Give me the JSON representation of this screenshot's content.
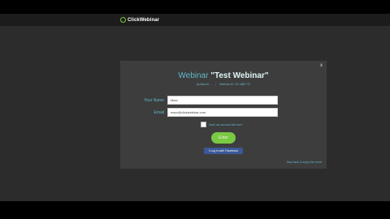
{
  "app": {
    "logo_text": "ClickWebinar"
  },
  "modal": {
    "close_label": "x",
    "title_prefix": "Webinar ",
    "title_name": "\"Test Webinar\"",
    "host_text": "by Marcel ....",
    "webinar_id_text": "Webinar ID: 207-888-772",
    "name_label": "Your Name",
    "name_value": "Marc",
    "email_label": "Email",
    "email_value": "marc@clickwebinar.com",
    "remember_label": "Save my account info here",
    "enter_button": "Enter",
    "facebook_button": "Log in with Facebook",
    "footer_link": "Stay back & enjoy the event"
  },
  "colors": {
    "accent": "#5fb8c8",
    "button_green": "#7ac943",
    "facebook_blue": "#3b5998",
    "modal_bg": "#3d3d3d"
  }
}
